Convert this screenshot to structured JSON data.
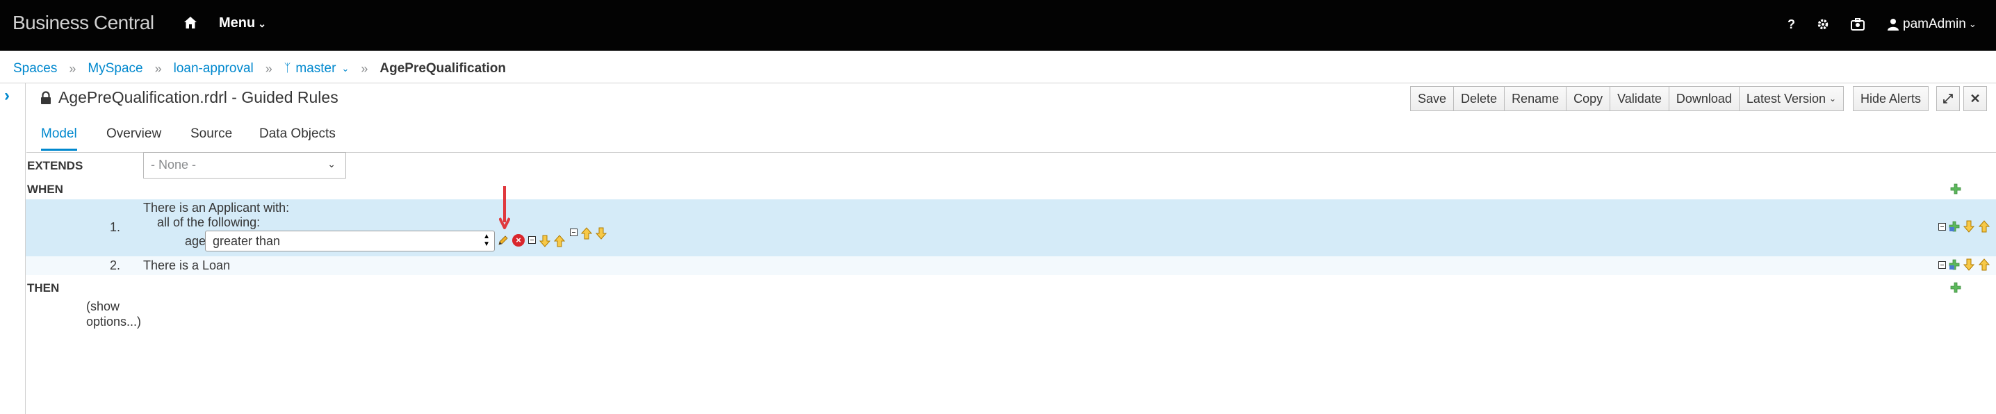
{
  "navbar": {
    "brand": "Business Central",
    "menu_label": "Menu",
    "help_label": "?",
    "user_label": "pamAdmin"
  },
  "breadcrumb": {
    "items": [
      "Spaces",
      "MySpace",
      "loan-approval",
      "master"
    ],
    "current": "AgePreQualification"
  },
  "editor": {
    "title": "AgePreQualification.rdrl - Guided Rules",
    "toolbar": {
      "main": [
        "Save",
        "Delete",
        "Rename",
        "Copy",
        "Validate",
        "Download",
        "Latest Version"
      ],
      "hide_alerts": "Hide Alerts",
      "expand_label": "⤢",
      "close_label": "✕"
    },
    "tabs": [
      "Model",
      "Overview",
      "Source",
      "Data Objects"
    ],
    "active_tab": "Model"
  },
  "rule": {
    "extends_label": "EXTENDS",
    "extends_value": "- None -",
    "when_label": "WHEN",
    "then_label": "THEN",
    "conditions": [
      {
        "number": "1.",
        "line1": "There is an Applicant with:",
        "line2": "all of the following:",
        "field": "age",
        "operator": "greater than"
      },
      {
        "number": "2.",
        "text": "There is a Loan"
      }
    ],
    "show_options_1": "(show",
    "show_options_2": "options...)"
  },
  "colors": {
    "navbar_bg": "#030303",
    "link": "#0088ce",
    "row_selected": "#d5ebf8",
    "row_alt": "#f3f9fd",
    "annotation_arrow": "#e0393e"
  },
  "icons": [
    "home-icon",
    "help-icon",
    "gear-icon",
    "briefcase-icon",
    "user-icon",
    "lock-icon",
    "pencil-icon",
    "remove-icon",
    "collapse-icon",
    "add-icon",
    "move-down-icon",
    "move-up-icon"
  ]
}
